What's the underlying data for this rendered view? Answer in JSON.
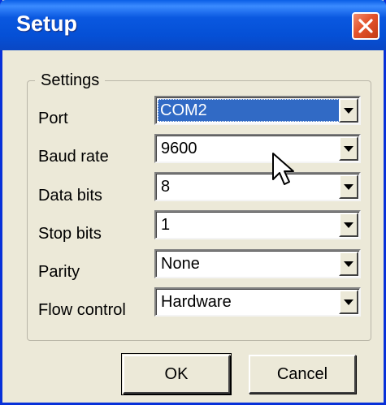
{
  "window": {
    "title": "Setup"
  },
  "settings": {
    "group_label": "Settings",
    "fields": [
      {
        "label": "Port",
        "value": "COM2"
      },
      {
        "label": "Baud rate",
        "value": "9600"
      },
      {
        "label": "Data bits",
        "value": "8"
      },
      {
        "label": "Stop bits",
        "value": "1"
      },
      {
        "label": "Parity",
        "value": "None"
      },
      {
        "label": "Flow control",
        "value": "Hardware"
      }
    ]
  },
  "buttons": {
    "ok": "OK",
    "cancel": "Cancel"
  },
  "icons": {
    "close": "close-icon",
    "dropdown": "chevron-down-icon",
    "pointer": "mouse-pointer-icon"
  },
  "colors": {
    "titlebar": "#0a58e0",
    "close": "#e4532b",
    "selection": "#316ac5",
    "face": "#ece9d8"
  }
}
